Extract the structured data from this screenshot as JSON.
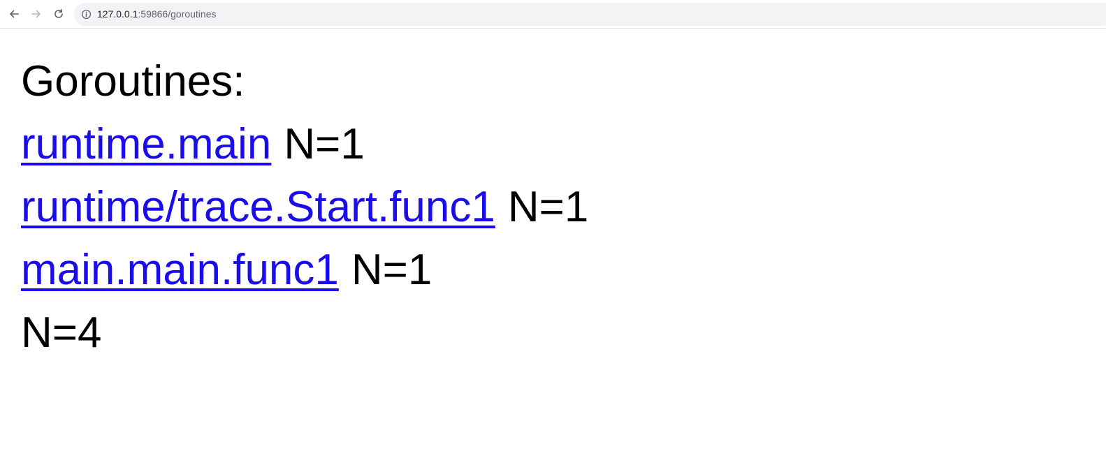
{
  "browser": {
    "url_host": "127.0.0.1",
    "url_rest": ":59866/goroutines"
  },
  "page": {
    "heading": "Goroutines:",
    "goroutines": [
      {
        "name": "runtime.main",
        "count": "N=1"
      },
      {
        "name": "runtime/trace.Start.func1",
        "count": "N=1"
      },
      {
        "name": "main.main.func1",
        "count": "N=1"
      }
    ],
    "total": "N=4"
  },
  "icons": {
    "back": "arrow-left-icon",
    "forward": "arrow-right-icon",
    "reload": "reload-icon",
    "info": "info-icon"
  },
  "colors": {
    "link": "#1a0dea",
    "text": "#000000",
    "address_bg": "#f1f3f4"
  }
}
